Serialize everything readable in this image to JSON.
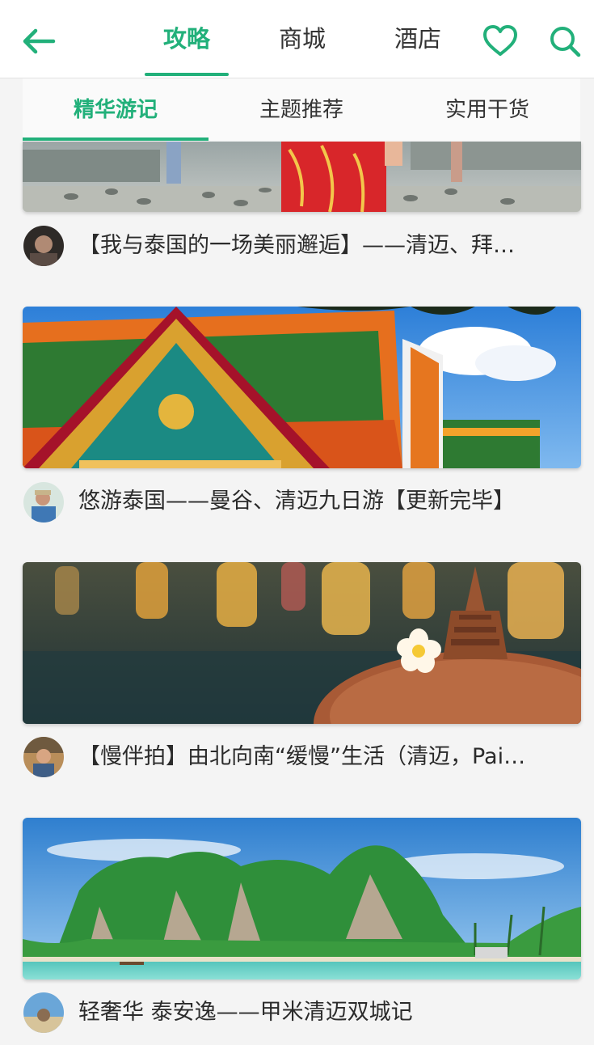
{
  "header": {
    "tabs": [
      {
        "label": "攻略",
        "active": true
      },
      {
        "label": "商城",
        "active": false
      },
      {
        "label": "酒店",
        "active": false
      }
    ],
    "icons": {
      "back": "arrow-left-icon",
      "favorite": "heart-icon",
      "search": "search-icon"
    },
    "accent_color": "#22b07a"
  },
  "subtabs": [
    {
      "label": "精华游记",
      "active": true
    },
    {
      "label": "主题推荐",
      "active": false
    },
    {
      "label": "实用干货",
      "active": false
    }
  ],
  "articles": [
    {
      "title": "【我与泰国的一场美丽邂逅】——清迈、拜…",
      "image": "street-photo"
    },
    {
      "title": "悠游泰国——曼谷、清迈九日游【更新完毕】",
      "image": "temple-roof-photo"
    },
    {
      "title": "【慢伴拍】由北向南“缓慢”生活（清迈，Pai…",
      "image": "stupa-flower-photo"
    },
    {
      "title": "轻奢华 泰安逸——甲米清迈双城记",
      "image": "island-photo"
    }
  ]
}
